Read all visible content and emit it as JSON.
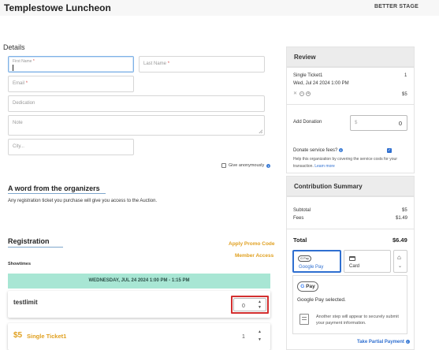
{
  "header": {
    "title": "Templestowe Luncheon",
    "brand": "BETTER STAGE"
  },
  "details": {
    "heading": "Details",
    "first_name": {
      "placeholder": "First Name",
      "required_mark": "*",
      "value": ""
    },
    "last_name": {
      "placeholder": "Last Name",
      "required_mark": "*"
    },
    "email": {
      "placeholder": "Email",
      "required_mark": "*"
    },
    "dedication": {
      "placeholder": "Dedication"
    },
    "note": {
      "placeholder": "Note"
    },
    "city": {
      "placeholder": "City..."
    },
    "anonymous_label": "Give anonymously",
    "anonymous_checked": false
  },
  "organizers": {
    "heading": "A word from the organizers",
    "text": "Any registration ticket you purchase will give you access to the Auction."
  },
  "registration": {
    "heading": "Registration",
    "promo_link": "Apply Promo Code",
    "member_link": "Member Access",
    "showtimes_label": "Showtimes",
    "date_band": "WEDNESDAY, JUL 24 2024 1:00 PM - 1:15 PM",
    "tickets": [
      {
        "name": "testlimit",
        "quantity": "0",
        "price": ""
      },
      {
        "name": "Single Ticket1",
        "quantity": "1",
        "price": "$5"
      }
    ]
  },
  "review": {
    "heading": "Review",
    "item_name": "Single Ticket1",
    "item_qty": "1",
    "item_date": "Wed, Jul 24 2024 1:00 PM",
    "item_price": "$5",
    "add_donation_label": "Add Donation",
    "donation_currency": "$",
    "donation_value": "0",
    "donate_fees_label": "Donate service fees?",
    "donate_fees_checked": true,
    "donate_fees_help": "Help this organization by covering the service costs for your transaction.",
    "learn_more": "Learn more"
  },
  "summary": {
    "heading": "Contribution Summary",
    "subtotal_label": "Subtotal",
    "subtotal_value": "$5",
    "fees_label": "Fees",
    "fees_value": "$1.49",
    "total_label": "Total",
    "total_value": "$6.49"
  },
  "payment": {
    "options": [
      {
        "label": "Google Pay",
        "icon": "gpay-icon",
        "selected": true
      },
      {
        "label": "Card",
        "icon": "card-icon",
        "selected": false
      },
      {
        "label": "",
        "icon": "bank-icon",
        "selected": false
      }
    ],
    "gpay_badge": "G Pay",
    "selected_text": "Google Pay selected.",
    "info_text": "Another step will appear to securely submit your payment information.",
    "partial_link": "Take Partial Payment"
  },
  "colors": {
    "accent_blue": "#2f6fd0",
    "accent_orange": "#e0a020",
    "band_green": "#a8e6d4",
    "highlight_red": "#d32f2f"
  }
}
